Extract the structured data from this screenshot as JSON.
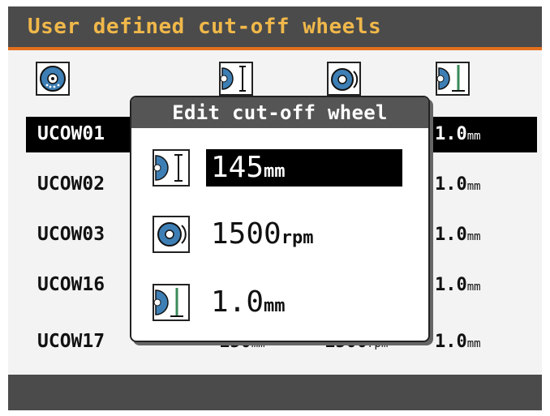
{
  "title": "User defined cut-off wheels",
  "header_icons": [
    "wheel-icon",
    "diameter-icon",
    "speed-icon",
    "thickness-icon"
  ],
  "rows": [
    {
      "name": "UCOW01",
      "diameter": "",
      "speed": "",
      "thickness": "1.0",
      "unit_thk": "mm",
      "selected": true
    },
    {
      "name": "UCOW02",
      "diameter": "",
      "speed": "",
      "thickness": "1.0",
      "unit_thk": "mm"
    },
    {
      "name": "UCOW03",
      "diameter": "",
      "speed": "",
      "thickness": "1.0",
      "unit_thk": "mm"
    },
    {
      "name": "UCOW16",
      "diameter": "",
      "speed": "",
      "thickness": "1.0",
      "unit_thk": "mm"
    },
    {
      "name": "UCOW17",
      "diameter": "150",
      "unit_dia": "mm",
      "speed": "1500",
      "unit_spd": "rpm",
      "thickness": "1.0",
      "unit_thk": "mm"
    }
  ],
  "dialog": {
    "title": "Edit cut-off wheel",
    "fields": [
      {
        "value": "145",
        "unit": "mm",
        "icon": "diameter-icon",
        "active": true
      },
      {
        "value": "1500",
        "unit": "rpm",
        "icon": "speed-icon"
      },
      {
        "value": "1.0",
        "unit": "mm",
        "icon": "thickness-icon"
      }
    ]
  },
  "colors": {
    "title_text": "#f0b84a",
    "accent": "#e36f1e",
    "bar": "#4b4b4b",
    "wheel": "#3d7fb5"
  }
}
